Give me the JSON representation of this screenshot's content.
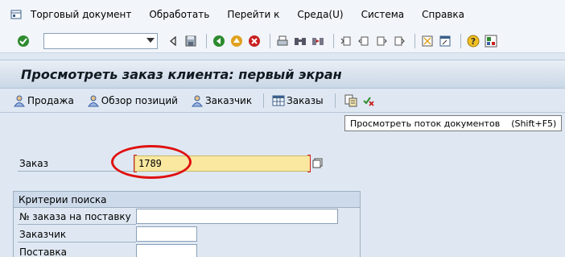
{
  "menu": {
    "items": [
      {
        "label": "Торговый документ"
      },
      {
        "label": "Обработать"
      },
      {
        "label": "Перейти к"
      },
      {
        "label": "Среда(U)"
      },
      {
        "label": "Система"
      },
      {
        "label": "Справка"
      }
    ]
  },
  "toolbar": {
    "command_value": "",
    "icons": [
      "enter-icon",
      "back-triangle-icon",
      "save-icon",
      "back-icon",
      "exit-icon",
      "cancel-icon",
      "print-icon",
      "find-icon",
      "find-next-icon",
      "first-page-icon",
      "previous-page-icon",
      "next-page-icon",
      "last-page-icon",
      "new-session-icon",
      "shortcut-icon",
      "help-icon",
      "layout-icon"
    ]
  },
  "title": "Просмотреть заказ клиента: первый экран",
  "app_toolbar": {
    "sales": "Продажа",
    "items_overview": "Обзор позиций",
    "customer": "Заказчик",
    "orders": "Заказы"
  },
  "tooltip": {
    "text": "Просмотреть поток документов",
    "shortcut": "(Shift+F5)"
  },
  "order": {
    "label": "Заказ",
    "value": "1789"
  },
  "search": {
    "title": "Критерии поиска",
    "delivery_order_label": "№ заказа на поставку",
    "customer_label": "Заказчик",
    "delivery_label": "Поставка",
    "delivery_order_value": "",
    "customer_value": "",
    "delivery_value": ""
  },
  "colors": {
    "accent_red": "#e01010",
    "input_highlight": "#fae8a0",
    "background": "#dfe8f2"
  }
}
